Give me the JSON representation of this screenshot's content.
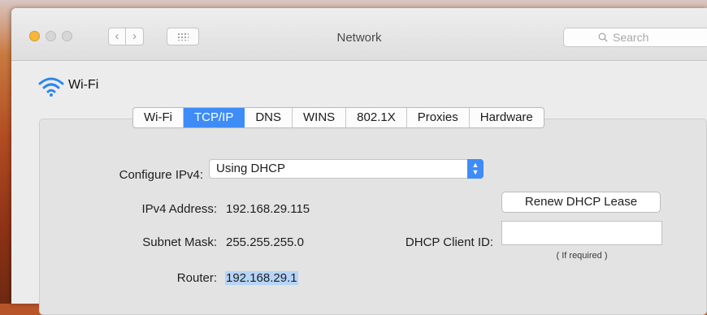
{
  "window": {
    "title": "Network",
    "search_placeholder": "Search"
  },
  "service": {
    "name": "Wi-Fi",
    "icon": "wifi-icon"
  },
  "tabs": [
    {
      "label": "Wi-Fi"
    },
    {
      "label": "TCP/IP",
      "active": true
    },
    {
      "label": "DNS"
    },
    {
      "label": "WINS"
    },
    {
      "label": "802.1X"
    },
    {
      "label": "Proxies"
    },
    {
      "label": "Hardware"
    }
  ],
  "tcpip": {
    "configure_label": "Configure IPv4:",
    "configure_value": "Using DHCP",
    "ipv4_label": "IPv4 Address:",
    "ipv4_value": "192.168.29.115",
    "subnet_label": "Subnet Mask:",
    "subnet_value": "255.255.255.0",
    "router_label": "Router:",
    "router_value": "192.168.29.1",
    "renew_button": "Renew DHCP Lease",
    "client_id_label": "DHCP Client ID:",
    "client_id_value": "",
    "client_id_hint": "( If required )"
  },
  "colors": {
    "accent": "#3f8cf6",
    "selection": "#b5d4f8"
  }
}
